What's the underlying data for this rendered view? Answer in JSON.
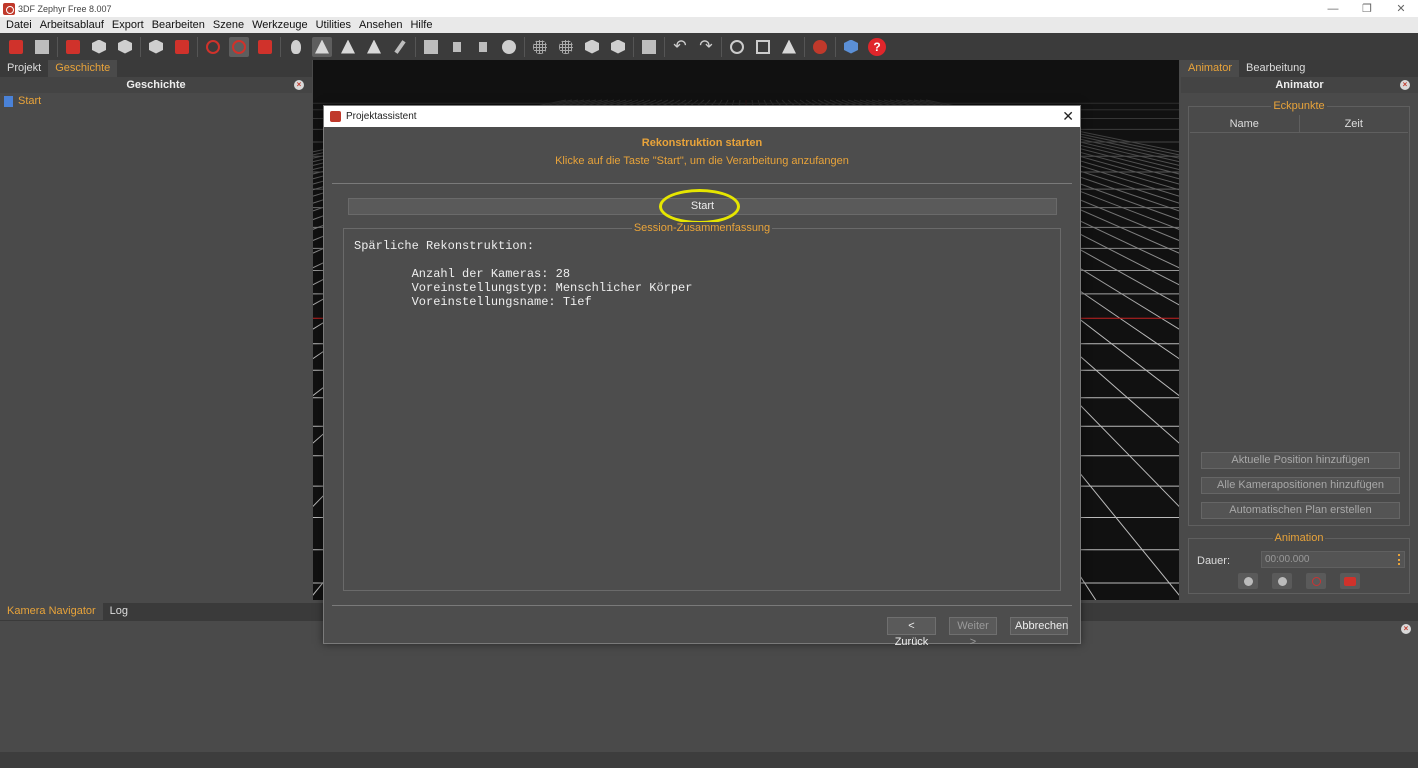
{
  "window": {
    "title": "3DF Zephyr Free 8.007",
    "controls": [
      "—",
      "❐",
      "✕"
    ]
  },
  "menu": [
    "Datei",
    "Arbeitsablauf",
    "Export",
    "Bearbeiten",
    "Szene",
    "Werkzeuge",
    "Utilities",
    "Ansehen",
    "Hilfe"
  ],
  "toolbar": {
    "help_glyph": "?",
    "undo_glyph": "↶",
    "redo_glyph": "↷"
  },
  "left": {
    "tabs": [
      "Projekt",
      "Geschichte"
    ],
    "selected_tab": "Geschichte",
    "header": "Geschichte",
    "tree": [
      {
        "label": "Start"
      }
    ]
  },
  "right": {
    "tabs": [
      "Animator",
      "Bearbeitung"
    ],
    "selected_tab": "Animator",
    "header": "Animator",
    "eckpunkte": {
      "title": "Eckpunkte",
      "columns": [
        "Name",
        "Zeit"
      ]
    },
    "buttons": [
      "Aktuelle Position hinzufügen",
      "Alle Kamerapositionen hinzufügen",
      "Automatischen Plan erstellen"
    ],
    "animation": {
      "title": "Animation",
      "duration_label": "Dauer:",
      "duration_value": "00:00.000"
    }
  },
  "bottom": {
    "tabs": [
      "Kamera Navigator",
      "Log"
    ],
    "selected_tab": "Kamera Navigator"
  },
  "dialog": {
    "title": "Projektassistent",
    "heading": "Rekonstruktion starten",
    "subheading": "Klicke auf die Taste \"Start\", um die Verarbeitung anzufangen",
    "start_label": "Start",
    "summary_title": "Session-Zusammenfassung",
    "summary_lines": [
      "Spärliche Rekonstruktion:",
      "",
      "        Anzahl der Kameras: 28",
      "        Voreinstellungstyp: Menschlicher Körper",
      "        Voreinstellungsname: Tief"
    ],
    "back_label": "< Zurück",
    "next_label": "Weiter >",
    "cancel_label": "Abbrechen"
  },
  "colors": {
    "accent": "#e8a33a",
    "highlight": "#e6e600",
    "grid_red": "#cc2222",
    "grid_white": "#bbbbbb"
  }
}
